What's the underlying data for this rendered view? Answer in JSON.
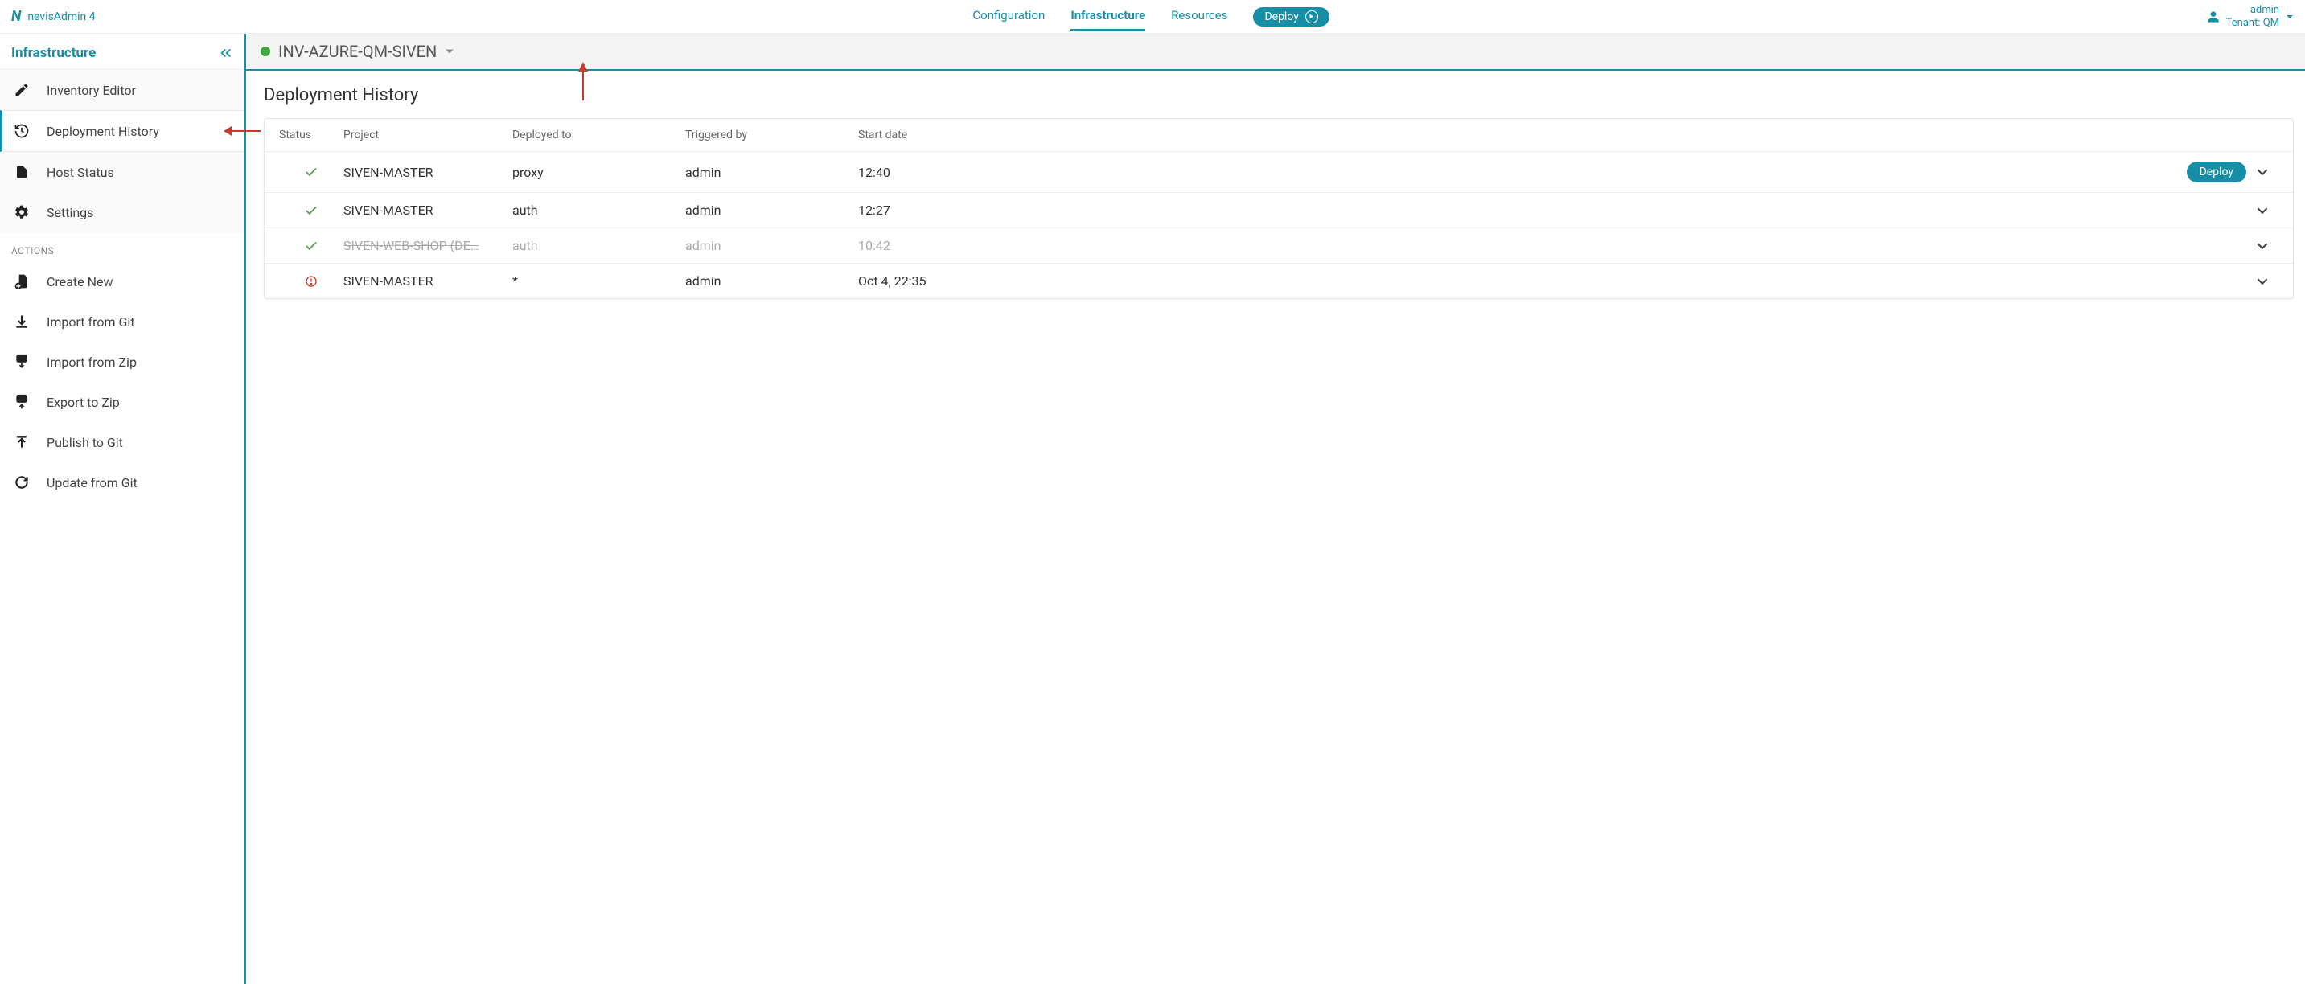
{
  "brand": {
    "logo_letter": "N",
    "name": "nevisAdmin 4"
  },
  "top_tabs": {
    "configuration": "Configuration",
    "infrastructure": "Infrastructure",
    "resources": "Resources",
    "deploy": "Deploy"
  },
  "user": {
    "name": "admin",
    "tenant_line": "Tenant: QM"
  },
  "sidebar": {
    "title": "Infrastructure",
    "nav": {
      "inventory_editor": "Inventory Editor",
      "deployment_history": "Deployment History",
      "host_status": "Host Status",
      "settings": "Settings"
    },
    "actions_label": "ACTIONS",
    "actions": {
      "create_new": "Create New",
      "import_git": "Import from Git",
      "import_zip": "Import from Zip",
      "export_zip": "Export to Zip",
      "publish_git": "Publish to Git",
      "update_git": "Update from Git"
    }
  },
  "inventory_bar": {
    "name": "INV-AZURE-QM-SIVEN"
  },
  "page": {
    "title": "Deployment History"
  },
  "table": {
    "headers": {
      "status": "Status",
      "project": "Project",
      "deployed_to": "Deployed to",
      "triggered_by": "Triggered by",
      "start_date": "Start date"
    },
    "row_deploy_label": "Deploy",
    "rows": [
      {
        "status": "ok",
        "project": "SIVEN-MASTER",
        "deployed_to": "proxy",
        "triggered_by": "admin",
        "start_date": "12:40",
        "show_deploy": true,
        "muted": false
      },
      {
        "status": "ok",
        "project": "SIVEN-MASTER",
        "deployed_to": "auth",
        "triggered_by": "admin",
        "start_date": "12:27",
        "show_deploy": false,
        "muted": false
      },
      {
        "status": "ok",
        "project": "SIVEN-WEB-SHOP (DE…",
        "deployed_to": "auth",
        "triggered_by": "admin",
        "start_date": "10:42",
        "show_deploy": false,
        "muted": true
      },
      {
        "status": "error",
        "project": "SIVEN-MASTER",
        "deployed_to": "*",
        "triggered_by": "admin",
        "start_date": "Oct 4, 22:35",
        "show_deploy": false,
        "muted": false
      }
    ]
  },
  "colors": {
    "brand": "#168EA6",
    "ok": "#5A9E4E",
    "error": "#C83C2D",
    "annotation": "#C83C2D"
  }
}
